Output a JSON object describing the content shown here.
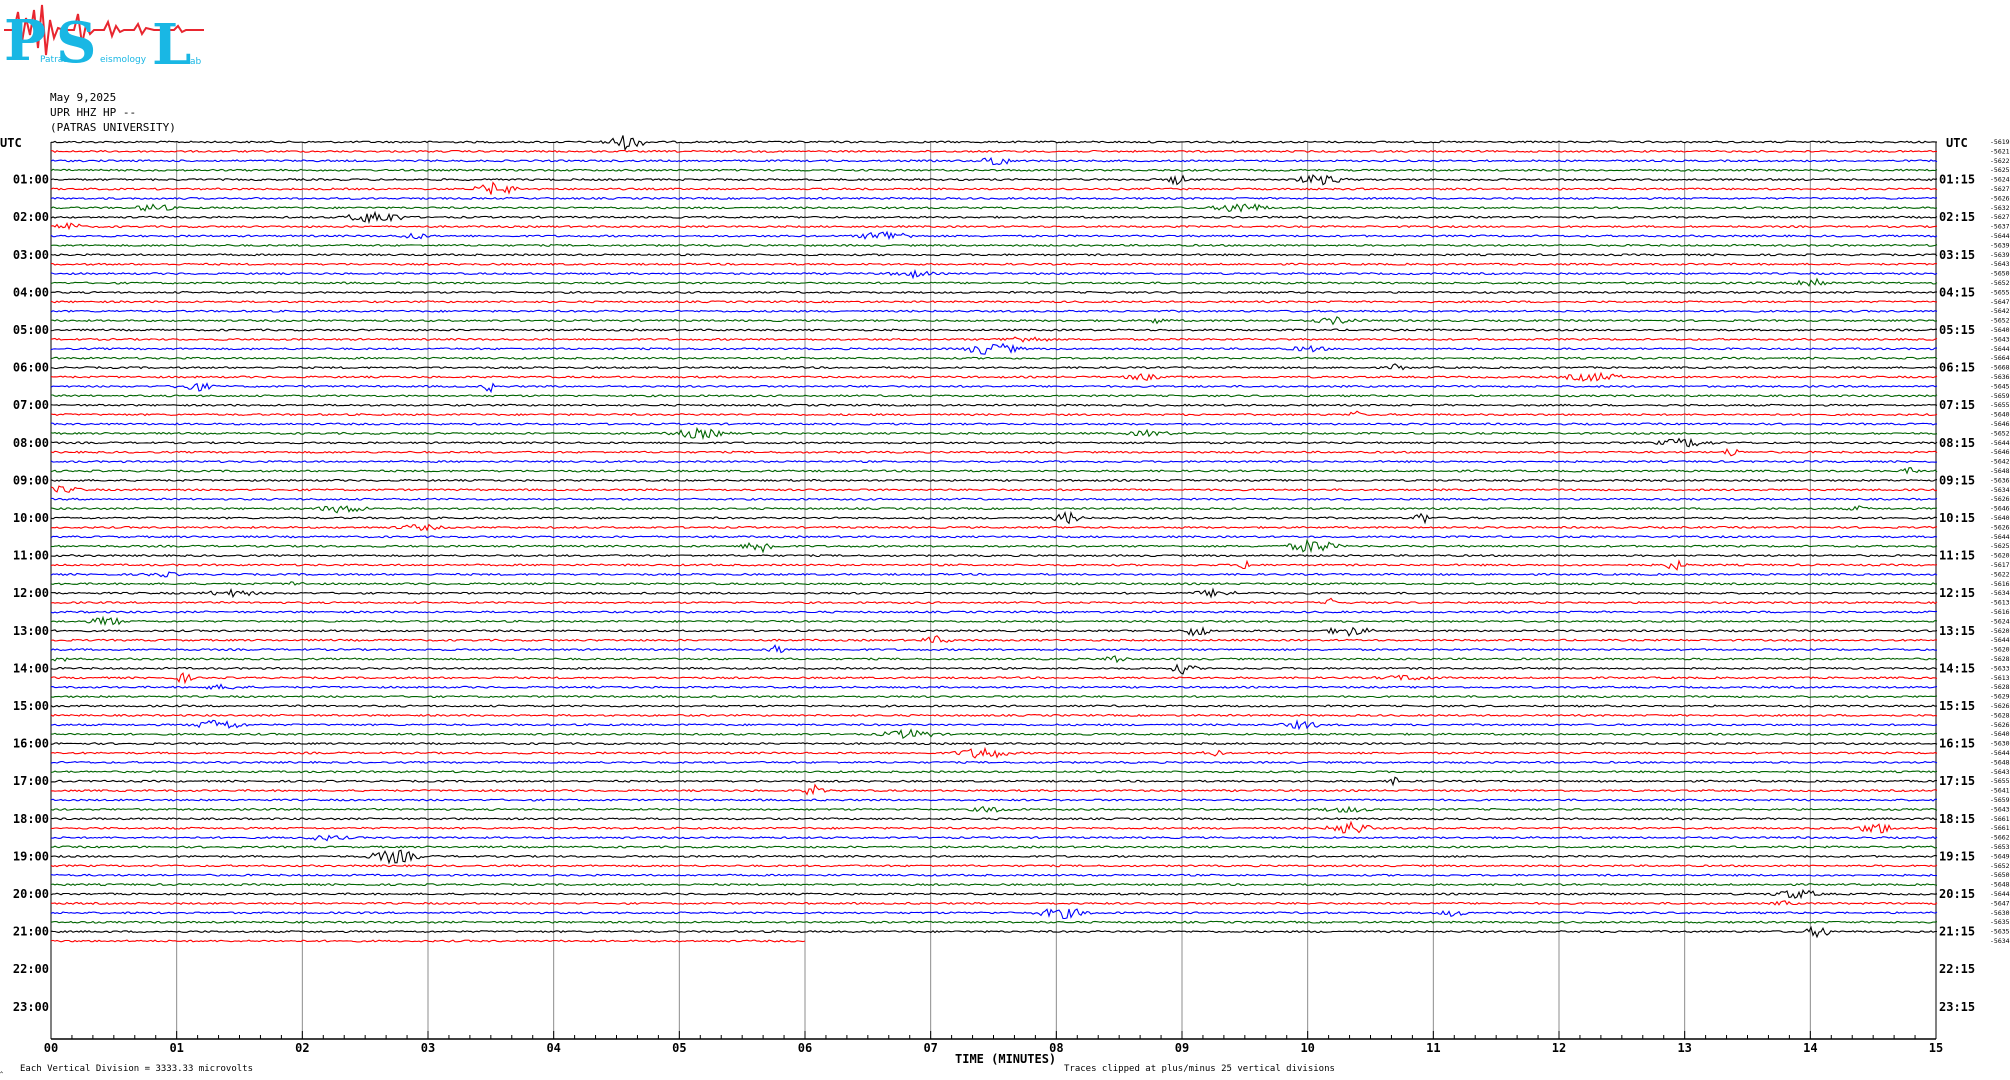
{
  "logo": {
    "letters": [
      "P",
      "S",
      "L"
    ],
    "small_words": [
      "Patras",
      "eismology",
      "ab"
    ],
    "colors": {
      "letters": "#19b7e4",
      "wave": "#e8262f"
    }
  },
  "header": {
    "date": "May 9,2025",
    "station": "UPR HHZ HP --",
    "institution": "(PATRAS UNIVERSITY)"
  },
  "utc_label_left": "UTC",
  "utc_label_right": "UTC",
  "footer": {
    "left_tick": "‸",
    "vertical_division": "Each Vertical Division = 3333.33 microvolts",
    "xlabel": "TIME (MINUTES)",
    "clip_note": "Traces clipped at plus/minus 25 vertical divisions"
  },
  "chart_data": {
    "type": "line",
    "subtype": "helicorder",
    "xlabel": "TIME (MINUTES)",
    "xlim": [
      0,
      15
    ],
    "x_ticks": [
      "00",
      "01",
      "02",
      "03",
      "04",
      "05",
      "06",
      "07",
      "08",
      "09",
      "10",
      "11",
      "12",
      "13",
      "14",
      "15"
    ],
    "left_hour_labels": [
      "01:00",
      "02:00",
      "03:00",
      "04:00",
      "05:00",
      "06:00",
      "07:00",
      "08:00",
      "09:00",
      "10:00",
      "11:00",
      "12:00",
      "13:00",
      "14:00",
      "15:00",
      "16:00",
      "17:00",
      "18:00",
      "19:00",
      "20:00",
      "21:00",
      "22:00",
      "23:00"
    ],
    "right_hour_labels": [
      "01:15",
      "02:15",
      "03:15",
      "04:15",
      "05:15",
      "06:15",
      "07:15",
      "08:15",
      "09:15",
      "10:15",
      "11:15",
      "12:15",
      "13:15",
      "14:15",
      "15:15",
      "16:15",
      "17:15",
      "18:15",
      "19:15",
      "20:15",
      "21:15",
      "22:15",
      "23:15"
    ],
    "trace_minutes": 15,
    "traces_per_hour": 4,
    "recorded_traces": 86,
    "last_trace_end_minute": 6,
    "trace_colors": [
      "#000000",
      "#ff0000",
      "#0000ff",
      "#006400"
    ],
    "offsets": [
      "-5619",
      "-5621",
      "-5622",
      "-5625",
      "-5624",
      "-5627",
      "-5626",
      "-5632",
      "-5627",
      "-5637",
      "-5644",
      "-5639",
      "-5639",
      "-5643",
      "-5650",
      "-5652",
      "-5655",
      "-5647",
      "-5642",
      "-5652",
      "-5640",
      "-5643",
      "-5644",
      "-5664",
      "-5668",
      "-5636",
      "-5645",
      "-5659",
      "-5655",
      "-5640",
      "-5646",
      "-5652",
      "-5644",
      "-5646",
      "-5642",
      "-5648",
      "-5636",
      "-5634",
      "-5626",
      "-5646",
      "-5640",
      "-5626",
      "-5644",
      "-5625",
      "-5620",
      "-5617",
      "-5622",
      "-5616",
      "-5634",
      "-5613",
      "-5616",
      "-5624",
      "-5620",
      "-5644",
      "-5620",
      "-5628",
      "-5633",
      "-5613",
      "-5628",
      "-5629",
      "-5626",
      "-5628",
      "-5626",
      "-5640",
      "-5630",
      "-5644",
      "-5648",
      "-5643",
      "-5655",
      "-5641",
      "-5659",
      "-5643",
      "-5661",
      "-5661",
      "-5662",
      "-5653",
      "-5649",
      "-5652",
      "-5650",
      "-5648",
      "-5644",
      "-5647",
      "-5630",
      "-5635",
      "-5635",
      "-5634",
      "-5640"
    ]
  }
}
